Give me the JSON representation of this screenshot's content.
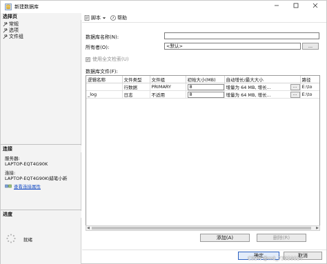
{
  "window": {
    "title": "新建数据库"
  },
  "left": {
    "select_page_header": "选择页",
    "pages": [
      {
        "label": "常规"
      },
      {
        "label": "选项"
      },
      {
        "label": "文件组"
      }
    ],
    "connection_header": "连接",
    "server_label": "服务器:",
    "server_value": "LAPTOP-EQT4G90K",
    "connection_label": "连接:",
    "connection_value": "LAPTOP-EQT4G90K\\蜡笔小新",
    "view_connection_props": "查看连接属性",
    "progress_header": "进度",
    "progress_status": "就绪"
  },
  "toolbar": {
    "script_label": "脚本",
    "help_label": "帮助"
  },
  "form": {
    "db_name_label": "数据库名称(N):",
    "db_name_value": "",
    "owner_label": "所有者(O):",
    "owner_value": "<默认>",
    "owner_browse": "...",
    "fulltext_label": "使用全文检索(U)",
    "fulltext_checked": true,
    "files_label": "数据库文件(F):"
  },
  "grid": {
    "columns": [
      "逻辑名称",
      "文件类型",
      "文件组",
      "初始大小(MB)",
      "自动增长/最大大小",
      "路径"
    ],
    "rows": [
      {
        "logical_name": "",
        "file_type": "行数据",
        "filegroup": "PRIMARY",
        "initial_size": "8",
        "autogrowth": "增量为 64 MB, 增长...",
        "growth_btn": "...",
        "path": "E:\\to"
      },
      {
        "logical_name": "_log",
        "file_type": "日志",
        "filegroup": "不适用",
        "initial_size": "8",
        "autogrowth": "增量为 64 MB, 增长...",
        "growth_btn": "...",
        "path": "E:\\to"
      }
    ]
  },
  "buttons": {
    "add": "添加(A)",
    "remove": "删除(R)",
    "ok": "确定",
    "cancel": "取消"
  },
  "watermark": "CSDN @m0_73956614",
  "colors": {
    "link": "#1a4fc4",
    "pane_bg": "#f3f3f3",
    "primary_border": "#2b5fbf"
  }
}
